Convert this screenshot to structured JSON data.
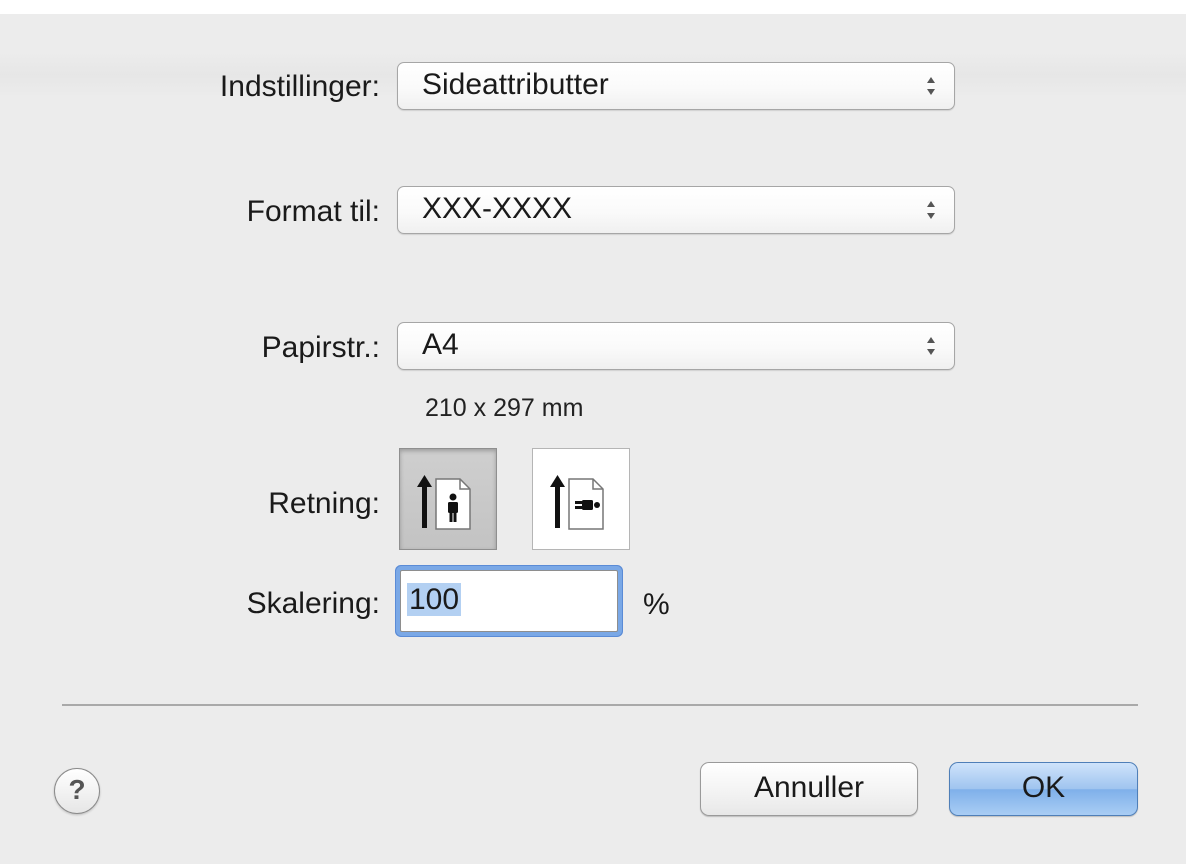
{
  "settings": {
    "label": "Indstillinger:",
    "value": "Sideattributter"
  },
  "format_for": {
    "label": "Format til:",
    "value": "XXX-XXXX"
  },
  "paper_size": {
    "label": "Papirstr.:",
    "value": "A4",
    "dimensions": "210 x 297 mm"
  },
  "orientation": {
    "label": "Retning:",
    "options": [
      "portrait",
      "landscape"
    ],
    "selected": "portrait"
  },
  "scale": {
    "label": "Skalering:",
    "value": "100",
    "unit": "%"
  },
  "buttons": {
    "help": "?",
    "cancel": "Annuller",
    "ok": "OK"
  },
  "colors": {
    "background": "#ececec",
    "ok_button": "#9fc4ef",
    "focus_ring": "#7aa8e6"
  }
}
